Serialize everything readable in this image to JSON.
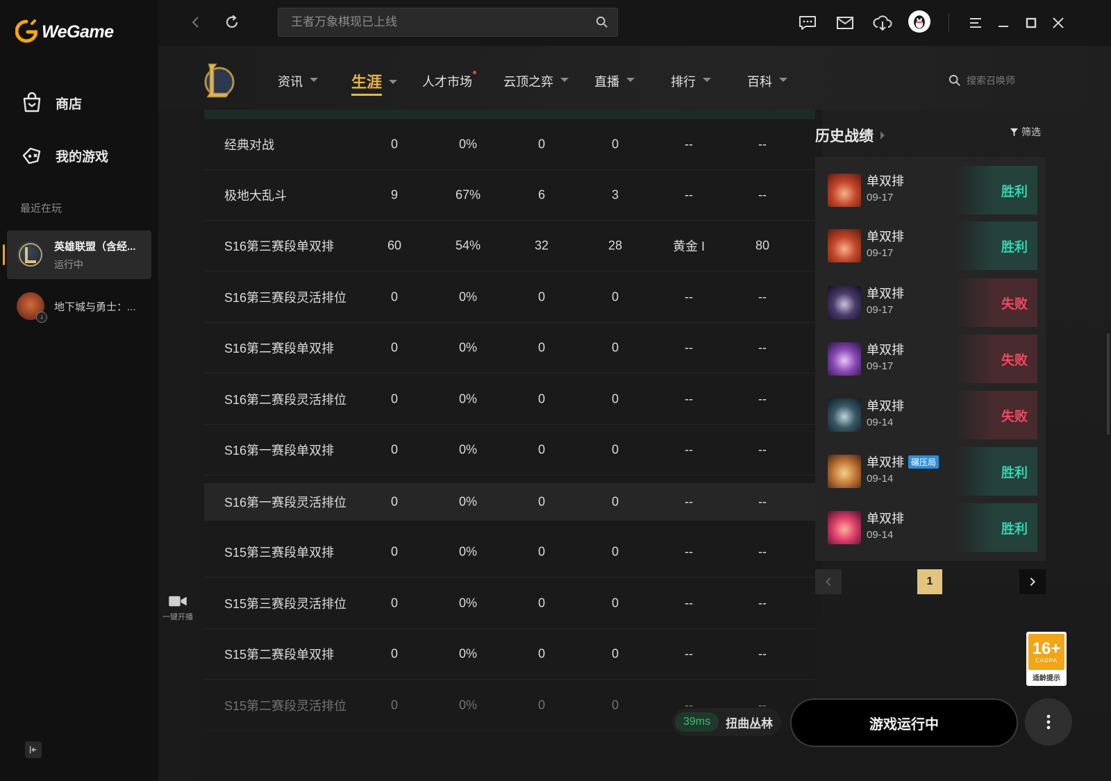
{
  "app": {
    "name": "WeGame",
    "accent": "#f2a516"
  },
  "sidebar": {
    "items": [
      {
        "label": "商店",
        "icon": "shop-bag-icon"
      },
      {
        "label": "我的游戏",
        "icon": "gamepad-icon"
      }
    ],
    "recent_label": "最近在玩",
    "recent_games": [
      {
        "title": "英雄联盟（含经...",
        "status": "运行中"
      },
      {
        "title": "地下城与勇士：..."
      }
    ]
  },
  "topbar": {
    "search_placeholder": "王者万象棋现已上线"
  },
  "game_nav": {
    "tabs": [
      {
        "label": "资讯"
      },
      {
        "label": "生涯"
      },
      {
        "label": "人才市场"
      },
      {
        "label": "云顶之弈"
      },
      {
        "label": "直播"
      },
      {
        "label": "排行"
      },
      {
        "label": "百科"
      }
    ],
    "summoner_search_placeholder": "搜索召唤师"
  },
  "stats": {
    "rows": [
      {
        "mode": "经典对战",
        "total": "0",
        "winrate": "0%",
        "wins": "0",
        "losses": "0",
        "rank": "--",
        "points": "--"
      },
      {
        "mode": "极地大乱斗",
        "total": "9",
        "winrate": "67%",
        "wins": "6",
        "losses": "3",
        "rank": "--",
        "points": "--"
      },
      {
        "mode": "S16第三赛段单双排",
        "total": "60",
        "winrate": "54%",
        "wins": "32",
        "losses": "28",
        "rank": "黄金 I",
        "points": "80"
      },
      {
        "mode": "S16第三赛段灵活排位",
        "total": "0",
        "winrate": "0%",
        "wins": "0",
        "losses": "0",
        "rank": "--",
        "points": "--"
      },
      {
        "mode": "S16第二赛段单双排",
        "total": "0",
        "winrate": "0%",
        "wins": "0",
        "losses": "0",
        "rank": "--",
        "points": "--"
      },
      {
        "mode": "S16第二赛段灵活排位",
        "total": "0",
        "winrate": "0%",
        "wins": "0",
        "losses": "0",
        "rank": "--",
        "points": "--"
      },
      {
        "mode": "S16第一赛段单双排",
        "total": "0",
        "winrate": "0%",
        "wins": "0",
        "losses": "0",
        "rank": "--",
        "points": "--"
      },
      {
        "mode": "S16第一赛段灵活排位",
        "total": "0",
        "winrate": "0%",
        "wins": "0",
        "losses": "0",
        "rank": "--",
        "points": "--"
      },
      {
        "mode": "S15第三赛段单双排",
        "total": "0",
        "winrate": "0%",
        "wins": "0",
        "losses": "0",
        "rank": "--",
        "points": "--"
      },
      {
        "mode": "S15第三赛段灵活排位",
        "total": "0",
        "winrate": "0%",
        "wins": "0",
        "losses": "0",
        "rank": "--",
        "points": "--"
      },
      {
        "mode": "S15第二赛段单双排",
        "total": "0",
        "winrate": "0%",
        "wins": "0",
        "losses": "0",
        "rank": "--",
        "points": "--"
      },
      {
        "mode": "S15第二赛段灵活排位",
        "total": "0",
        "winrate": "0%",
        "wins": "0",
        "losses": "0",
        "rank": "--",
        "points": "--"
      }
    ]
  },
  "stream": {
    "label": "一键开播"
  },
  "history": {
    "title": "历史战绩",
    "filter_label": "筛选",
    "matches": [
      {
        "mode": "单双排",
        "date": "09-17",
        "result": "胜利",
        "outcome": "win",
        "badge": ""
      },
      {
        "mode": "单双排",
        "date": "09-17",
        "result": "胜利",
        "outcome": "win",
        "badge": ""
      },
      {
        "mode": "单双排",
        "date": "09-17",
        "result": "失败",
        "outcome": "loss",
        "badge": ""
      },
      {
        "mode": "单双排",
        "date": "09-17",
        "result": "失败",
        "outcome": "loss",
        "badge": ""
      },
      {
        "mode": "单双排",
        "date": "09-14",
        "result": "失败",
        "outcome": "loss",
        "badge": ""
      },
      {
        "mode": "单双排",
        "date": "09-14",
        "result": "胜利",
        "outcome": "win",
        "badge": "碾压局"
      },
      {
        "mode": "单双排",
        "date": "09-14",
        "result": "胜利",
        "outcome": "win",
        "badge": ""
      }
    ],
    "page": "1"
  },
  "age_rating": {
    "number": "16+",
    "org": "CADPA",
    "tip": "适龄提示"
  },
  "bottom": {
    "ping": "39ms",
    "server": "扭曲丛林",
    "launch_label": "游戏运行中"
  }
}
